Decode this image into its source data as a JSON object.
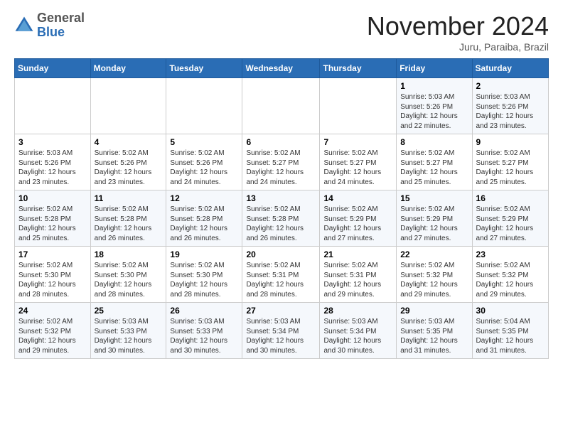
{
  "header": {
    "logo_general": "General",
    "logo_blue": "Blue",
    "month_title": "November 2024",
    "location": "Juru, Paraiba, Brazil"
  },
  "days_of_week": [
    "Sunday",
    "Monday",
    "Tuesday",
    "Wednesday",
    "Thursday",
    "Friday",
    "Saturday"
  ],
  "weeks": [
    [
      {
        "day": "",
        "info": ""
      },
      {
        "day": "",
        "info": ""
      },
      {
        "day": "",
        "info": ""
      },
      {
        "day": "",
        "info": ""
      },
      {
        "day": "",
        "info": ""
      },
      {
        "day": "1",
        "info": "Sunrise: 5:03 AM\nSunset: 5:26 PM\nDaylight: 12 hours\nand 22 minutes."
      },
      {
        "day": "2",
        "info": "Sunrise: 5:03 AM\nSunset: 5:26 PM\nDaylight: 12 hours\nand 23 minutes."
      }
    ],
    [
      {
        "day": "3",
        "info": "Sunrise: 5:03 AM\nSunset: 5:26 PM\nDaylight: 12 hours\nand 23 minutes."
      },
      {
        "day": "4",
        "info": "Sunrise: 5:02 AM\nSunset: 5:26 PM\nDaylight: 12 hours\nand 23 minutes."
      },
      {
        "day": "5",
        "info": "Sunrise: 5:02 AM\nSunset: 5:26 PM\nDaylight: 12 hours\nand 24 minutes."
      },
      {
        "day": "6",
        "info": "Sunrise: 5:02 AM\nSunset: 5:27 PM\nDaylight: 12 hours\nand 24 minutes."
      },
      {
        "day": "7",
        "info": "Sunrise: 5:02 AM\nSunset: 5:27 PM\nDaylight: 12 hours\nand 24 minutes."
      },
      {
        "day": "8",
        "info": "Sunrise: 5:02 AM\nSunset: 5:27 PM\nDaylight: 12 hours\nand 25 minutes."
      },
      {
        "day": "9",
        "info": "Sunrise: 5:02 AM\nSunset: 5:27 PM\nDaylight: 12 hours\nand 25 minutes."
      }
    ],
    [
      {
        "day": "10",
        "info": "Sunrise: 5:02 AM\nSunset: 5:28 PM\nDaylight: 12 hours\nand 25 minutes."
      },
      {
        "day": "11",
        "info": "Sunrise: 5:02 AM\nSunset: 5:28 PM\nDaylight: 12 hours\nand 26 minutes."
      },
      {
        "day": "12",
        "info": "Sunrise: 5:02 AM\nSunset: 5:28 PM\nDaylight: 12 hours\nand 26 minutes."
      },
      {
        "day": "13",
        "info": "Sunrise: 5:02 AM\nSunset: 5:28 PM\nDaylight: 12 hours\nand 26 minutes."
      },
      {
        "day": "14",
        "info": "Sunrise: 5:02 AM\nSunset: 5:29 PM\nDaylight: 12 hours\nand 27 minutes."
      },
      {
        "day": "15",
        "info": "Sunrise: 5:02 AM\nSunset: 5:29 PM\nDaylight: 12 hours\nand 27 minutes."
      },
      {
        "day": "16",
        "info": "Sunrise: 5:02 AM\nSunset: 5:29 PM\nDaylight: 12 hours\nand 27 minutes."
      }
    ],
    [
      {
        "day": "17",
        "info": "Sunrise: 5:02 AM\nSunset: 5:30 PM\nDaylight: 12 hours\nand 28 minutes."
      },
      {
        "day": "18",
        "info": "Sunrise: 5:02 AM\nSunset: 5:30 PM\nDaylight: 12 hours\nand 28 minutes."
      },
      {
        "day": "19",
        "info": "Sunrise: 5:02 AM\nSunset: 5:30 PM\nDaylight: 12 hours\nand 28 minutes."
      },
      {
        "day": "20",
        "info": "Sunrise: 5:02 AM\nSunset: 5:31 PM\nDaylight: 12 hours\nand 28 minutes."
      },
      {
        "day": "21",
        "info": "Sunrise: 5:02 AM\nSunset: 5:31 PM\nDaylight: 12 hours\nand 29 minutes."
      },
      {
        "day": "22",
        "info": "Sunrise: 5:02 AM\nSunset: 5:32 PM\nDaylight: 12 hours\nand 29 minutes."
      },
      {
        "day": "23",
        "info": "Sunrise: 5:02 AM\nSunset: 5:32 PM\nDaylight: 12 hours\nand 29 minutes."
      }
    ],
    [
      {
        "day": "24",
        "info": "Sunrise: 5:02 AM\nSunset: 5:32 PM\nDaylight: 12 hours\nand 29 minutes."
      },
      {
        "day": "25",
        "info": "Sunrise: 5:03 AM\nSunset: 5:33 PM\nDaylight: 12 hours\nand 30 minutes."
      },
      {
        "day": "26",
        "info": "Sunrise: 5:03 AM\nSunset: 5:33 PM\nDaylight: 12 hours\nand 30 minutes."
      },
      {
        "day": "27",
        "info": "Sunrise: 5:03 AM\nSunset: 5:34 PM\nDaylight: 12 hours\nand 30 minutes."
      },
      {
        "day": "28",
        "info": "Sunrise: 5:03 AM\nSunset: 5:34 PM\nDaylight: 12 hours\nand 30 minutes."
      },
      {
        "day": "29",
        "info": "Sunrise: 5:03 AM\nSunset: 5:35 PM\nDaylight: 12 hours\nand 31 minutes."
      },
      {
        "day": "30",
        "info": "Sunrise: 5:04 AM\nSunset: 5:35 PM\nDaylight: 12 hours\nand 31 minutes."
      }
    ]
  ]
}
